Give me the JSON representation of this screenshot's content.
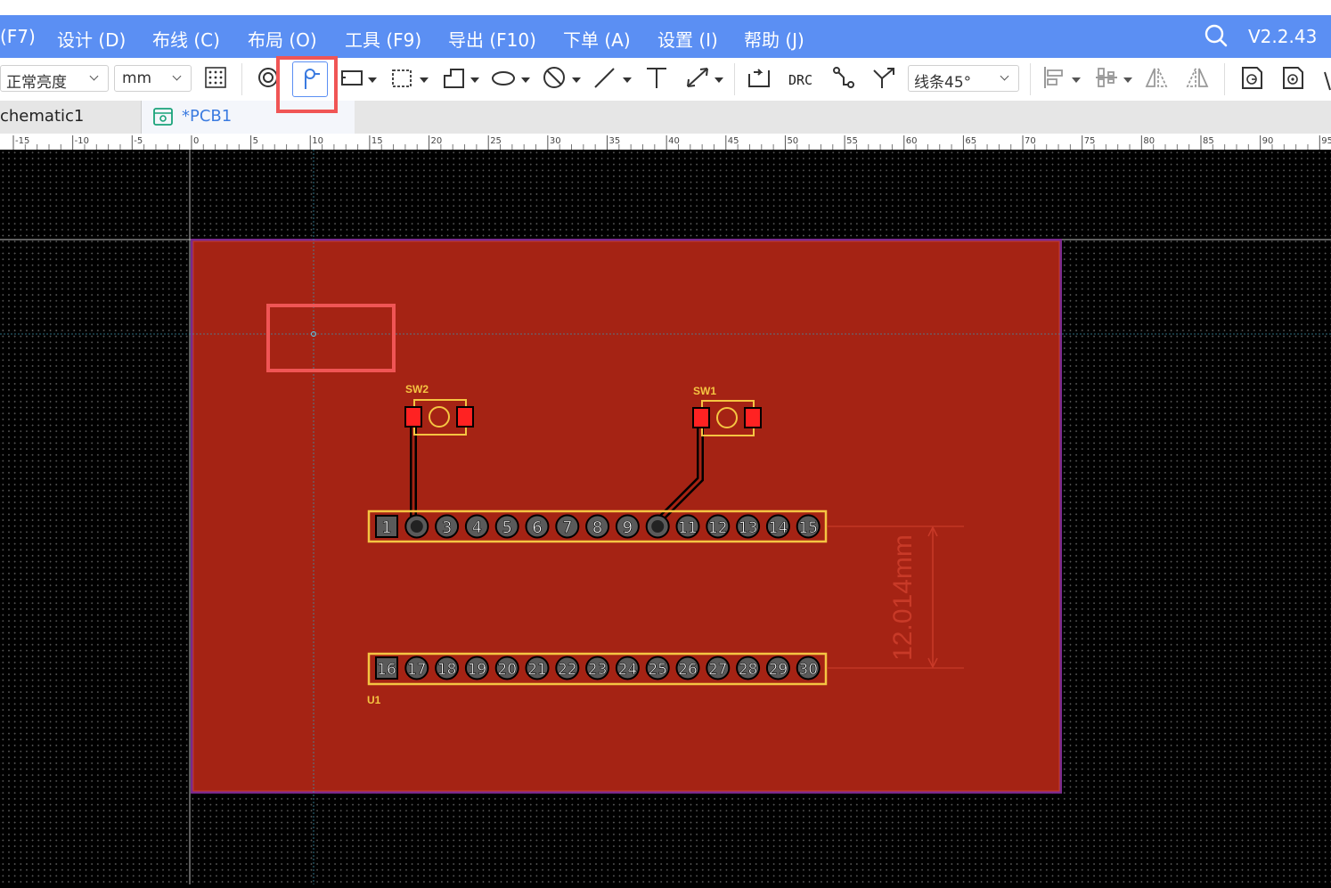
{
  "menu": {
    "items": [
      "(F7)",
      "设计 (D)",
      "布线 (C)",
      "布局 (O)",
      "工具 (F9)",
      "导出 (F10)",
      "下单 (A)",
      "设置 (I)",
      "帮助 (J)"
    ],
    "version": "V2.2.43"
  },
  "toolbar": {
    "brightness_value": "正常亮度",
    "unit_value": "mm",
    "route_mode_value": "线条45°",
    "drc_label": "DRC",
    "icons": [
      "grid-icon",
      "pad-icon",
      "via-tool-icon",
      "rect-select-icon",
      "dashed-rect-icon",
      "polygon-icon",
      "ellipse-icon",
      "no-entry-icon",
      "line-icon",
      "text-icon",
      "dimension-icon",
      "route-icon",
      "drc-icon",
      "single-route-icon",
      "diff-route-icon",
      "align-left-icon",
      "align-bottom-icon",
      "flip-h-icon",
      "flip-v-icon",
      "gerber-icon",
      "pick-place-icon"
    ]
  },
  "tabs": {
    "schematic": "chematic1",
    "pcb": "*PCB1"
  },
  "ruler": {
    "labels": [
      "-15",
      "-10",
      "-5",
      "0",
      "5",
      "10",
      "15",
      "20",
      "25",
      "30",
      "35",
      "40",
      "45",
      "50",
      "55",
      "60",
      "65",
      "70",
      "75",
      "80",
      "85",
      "90",
      "95"
    ]
  },
  "pcb": {
    "colors": {
      "board": "#a52314",
      "outline": "#7b2a8c",
      "silkscreen": "#f5c542",
      "pad": "#ff2222",
      "highlight": "#f05555",
      "accent": "#5b8ff3"
    },
    "components": {
      "sw2": "SW2",
      "sw1": "SW1",
      "u1": "U1"
    },
    "header_top_pins": [
      "1",
      "",
      "3",
      "4",
      "5",
      "6",
      "7",
      "8",
      "9",
      "",
      "11",
      "12",
      "13",
      "14",
      "15"
    ],
    "header_bottom_pins": [
      "16",
      "17",
      "18",
      "19",
      "20",
      "21",
      "22",
      "23",
      "24",
      "25",
      "26",
      "27",
      "28",
      "29",
      "30"
    ],
    "dimension_label": "12.014mm"
  }
}
